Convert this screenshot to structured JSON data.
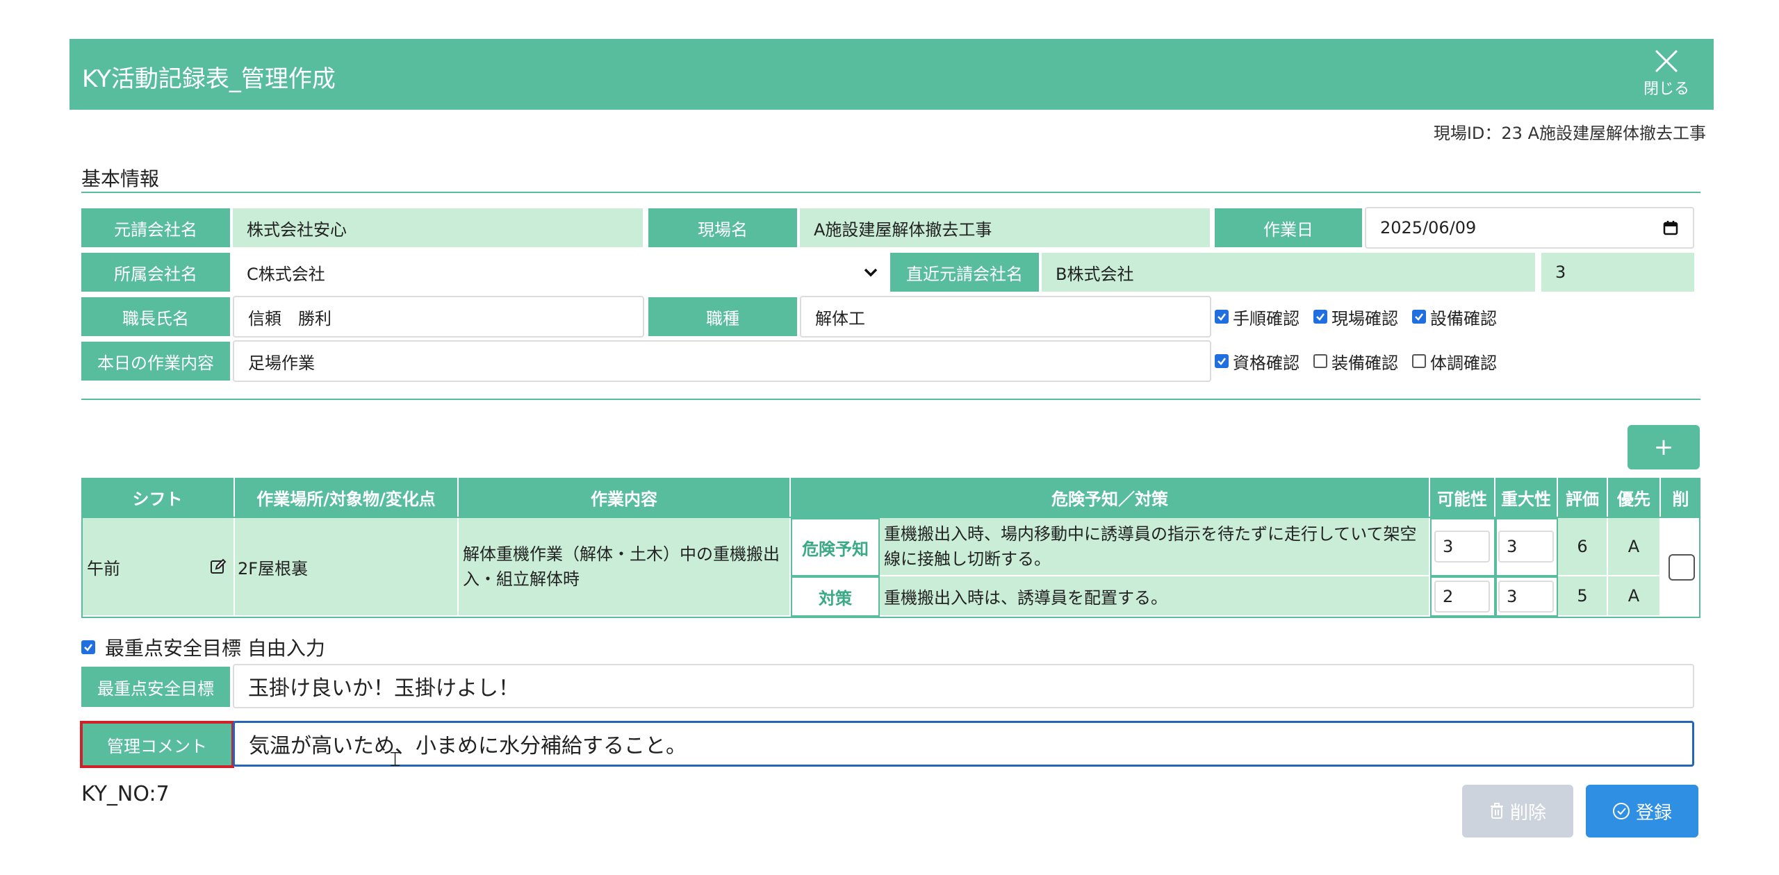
{
  "header": {
    "title": "KY活動記録表_管理作成",
    "close_label": "閉じる"
  },
  "site_id_text": "現場ID：23 A施設建屋解体撤去工事",
  "basic_info": {
    "section_title": "基本情報",
    "prime_company_label": "元請会社名",
    "prime_company_value": "株式会社安心",
    "site_name_label": "現場名",
    "site_name_value": "A施設建屋解体撤去工事",
    "work_date_label": "作業日",
    "work_date_value": "2025/06/09",
    "affiliate_label": "所属会社名",
    "affiliate_value": "C株式会社",
    "direct_prime_label": "直近元請会社名",
    "direct_prime_value": "B株式会社",
    "direct_prime_extra": "3",
    "foreman_label": "職長氏名",
    "foreman_value": "信頼　勝利",
    "job_type_label": "職種",
    "job_type_value": "解体工",
    "work_content_label": "本日の作業内容",
    "work_content_value": "足場作業",
    "checks_row1": [
      {
        "label": "手順確認",
        "checked": true
      },
      {
        "label": "現場確認",
        "checked": true
      },
      {
        "label": "設備確認",
        "checked": true
      }
    ],
    "checks_row2": [
      {
        "label": "資格確認",
        "checked": true
      },
      {
        "label": "装備確認",
        "checked": false
      },
      {
        "label": "体調確認",
        "checked": false
      }
    ]
  },
  "add_button_label": "+",
  "table": {
    "headers": [
      "シフト",
      "作業場所/対象物/変化点",
      "作業内容",
      "危険予知／対策",
      "可能性",
      "重大性",
      "評価",
      "優先",
      "削"
    ],
    "row": {
      "shift": "午前",
      "place": "2F屋根裏",
      "work": "解体重機作業（解体・土木）中の重機搬出入・組立解体時",
      "danger_tag": "危険予知",
      "danger_text": "重機搬出入時、場内移動中に誘導員の指示を待たずに走行していて架空線に接触し切断する。",
      "danger_possibility": "3",
      "danger_severity": "3",
      "danger_eval": "6",
      "danger_priority": "A",
      "measure_tag": "対策",
      "measure_text": "重機搬出入時は、誘導員を配置する。",
      "measure_possibility": "2",
      "measure_severity": "3",
      "measure_eval": "5",
      "measure_priority": "A"
    }
  },
  "free_input_check_label": "最重点安全目標 自由入力",
  "safety_goal_label": "最重点安全目標",
  "safety_goal_value": "玉掛け良いか！玉掛けよし！",
  "mgmt_comment_label": "管理コメント",
  "mgmt_comment_value": "気温が高いため、小まめに水分補給すること。",
  "ky_no": "KY_NO:7",
  "delete_button": "削除",
  "register_button": "登録",
  "colors": {
    "accent": "#58bd9c",
    "readonly": "#c9edd6",
    "primary": "#2f8fe3",
    "focus": "#2366b7"
  }
}
